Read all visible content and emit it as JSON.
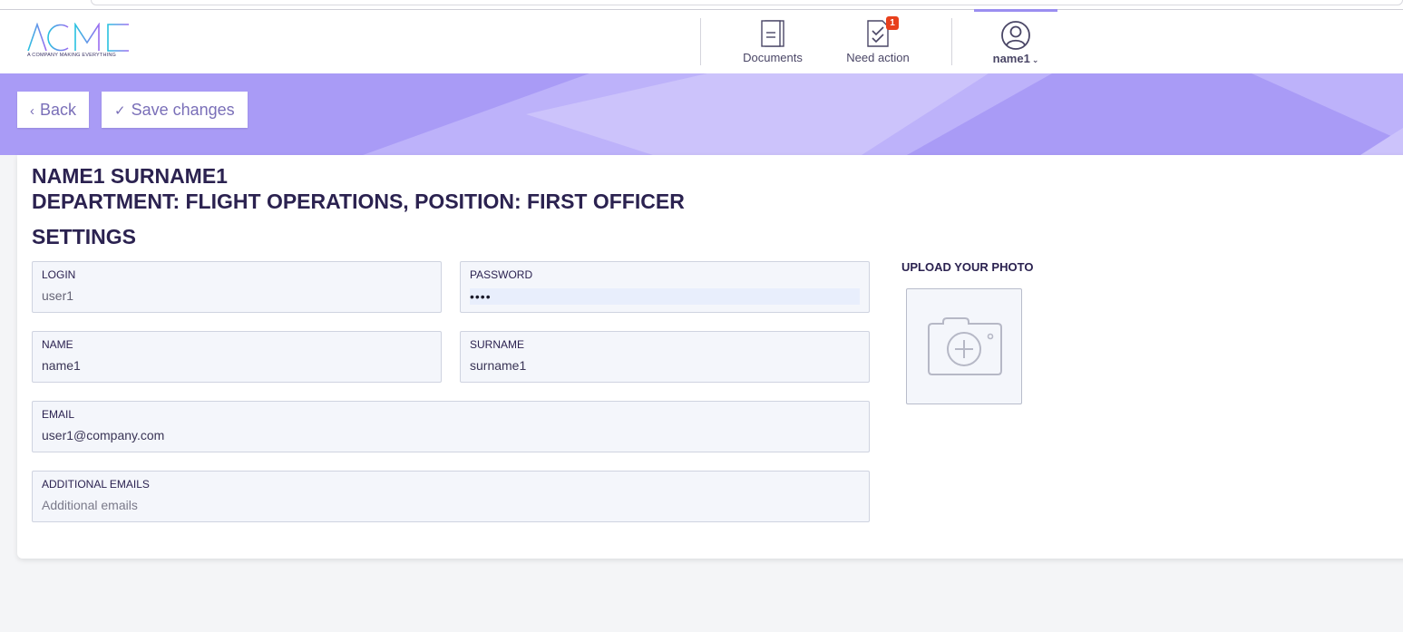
{
  "brand": {
    "name": "ACME",
    "tagline": "A COMPANY MAKING EVERYTHING"
  },
  "nav": {
    "documents": {
      "label": "Documents",
      "icon": "document-icon"
    },
    "need_action": {
      "label": "Need action",
      "icon": "checklist-icon",
      "badge": "1"
    },
    "user": {
      "label": "name1",
      "icon": "user-circle-icon"
    }
  },
  "toolbar": {
    "back_label": "Back",
    "save_label": "Save changes"
  },
  "profile": {
    "name_heading": "NAME1 SURNAME1",
    "department_heading": "DEPARTMENT: FLIGHT OPERATIONS, POSITION: FIRST OFFICER",
    "settings_heading": "SETTINGS"
  },
  "form": {
    "login": {
      "label": "LOGIN",
      "value": "user1"
    },
    "password": {
      "label": "PASSWORD",
      "value": "••••"
    },
    "name": {
      "label": "NAME",
      "value": "name1"
    },
    "surname": {
      "label": "SURNAME",
      "value": "surname1"
    },
    "email": {
      "label": "EMAIL",
      "value": "user1@company.com"
    },
    "additional_emails": {
      "label": "ADDITIONAL EMAILS",
      "placeholder": "Additional emails"
    }
  },
  "upload": {
    "label": "UPLOAD YOUR PHOTO",
    "icon": "camera-add-icon"
  },
  "colors": {
    "accent": "#a99bf6",
    "heading": "#2b2250",
    "badge": "#e8401c",
    "logo_gradient": [
      "#27c2e0",
      "#9b6cf0"
    ]
  }
}
